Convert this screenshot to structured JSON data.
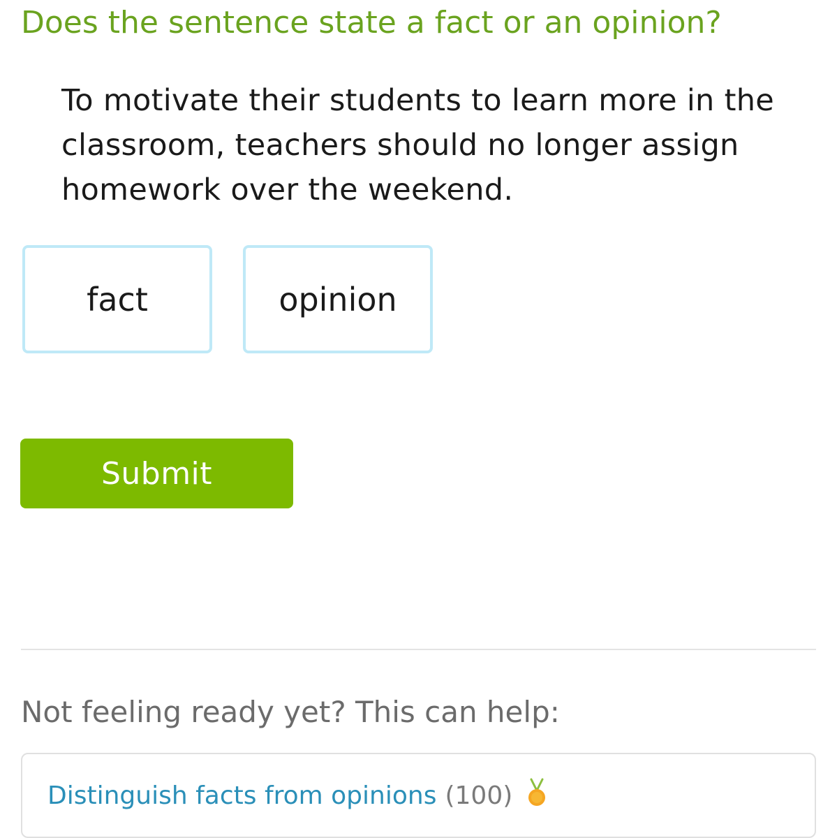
{
  "question": {
    "prompt": "Does the sentence state a fact or an opinion?",
    "sentence": "To motivate their students to learn more in the classroom, teachers should no longer assign homework over the weekend."
  },
  "choices": [
    {
      "label": "fact"
    },
    {
      "label": "opinion"
    }
  ],
  "actions": {
    "submit_label": "Submit"
  },
  "help": {
    "intro": "Not feeling ready yet? This can help:",
    "skill_name": "Distinguish facts from opinions",
    "skill_score": "(100)",
    "medal_icon": "medal-icon"
  },
  "colors": {
    "prompt": "#6aa31f",
    "choice_border": "#bfe9f7",
    "submit_bg": "#7dba00",
    "link": "#2a8fb8",
    "medal": "#f5a623"
  }
}
